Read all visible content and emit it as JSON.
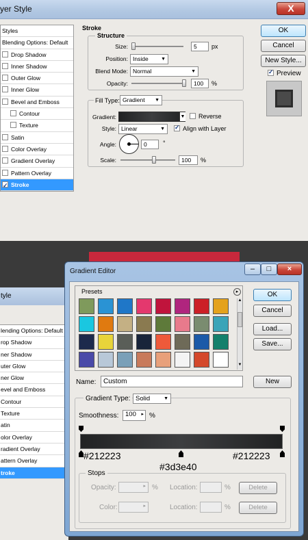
{
  "layer_style": {
    "title": "yer Style",
    "close": "X",
    "nav": [
      {
        "label": "Styles",
        "type": "header"
      },
      {
        "label": "Blending Options: Default",
        "type": "header"
      },
      {
        "label": "Drop Shadow",
        "checked": false
      },
      {
        "label": "Inner Shadow",
        "checked": false
      },
      {
        "label": "Outer Glow",
        "checked": false
      },
      {
        "label": "Inner Glow",
        "checked": false
      },
      {
        "label": "Bevel and Emboss",
        "checked": false
      },
      {
        "label": "Contour",
        "checked": false,
        "sub": true
      },
      {
        "label": "Texture",
        "checked": false,
        "sub": true
      },
      {
        "label": "Satin",
        "checked": false
      },
      {
        "label": "Color Overlay",
        "checked": false
      },
      {
        "label": "Gradient Overlay",
        "checked": false
      },
      {
        "label": "Pattern Overlay",
        "checked": false
      },
      {
        "label": "Stroke",
        "checked": true,
        "selected": true
      }
    ],
    "stroke": {
      "heading": "Stroke",
      "structure_heading": "Structure",
      "size_label": "Size:",
      "size_value": "5",
      "size_unit": "px",
      "position_label": "Position:",
      "position_value": "Inside",
      "blend_label": "Blend Mode:",
      "blend_value": "Normal",
      "opacity_label": "Opacity:",
      "opacity_value": "100",
      "opacity_unit": "%",
      "fill_type_label": "Fill Type:",
      "fill_type_value": "Gradient",
      "gradient_label": "Gradient:",
      "reverse_label": "Reverse",
      "style_label": "Style:",
      "style_value": "Linear",
      "align_label": "Align with Layer",
      "angle_label": "Angle:",
      "angle_value": "0",
      "angle_unit": "°",
      "scale_label": "Scale:",
      "scale_value": "100",
      "scale_unit": "%"
    },
    "buttons": {
      "ok": "OK",
      "cancel": "Cancel",
      "new_style": "New Style...",
      "preview": "Preview"
    }
  },
  "background_window": {
    "title": "tyle",
    "nav": [
      "lending Options: Default",
      "rop Shadow",
      "ner Shadow",
      "uter Glow",
      "ner Glow",
      "evel and Emboss",
      "Contour",
      "Texture",
      "atin",
      "olor Overlay",
      "radient Overlay",
      "attern Overlay",
      "troke"
    ]
  },
  "gradient_editor": {
    "title": "Gradient Editor",
    "presets_label": "Presets",
    "swatches": [
      [
        "#7f9a5c",
        "#2a93d4",
        "#1f77c8",
        "#e4386e",
        "#c0143c",
        "#b0257e",
        "#cc1f26",
        "#e4a21c"
      ],
      [
        "#1ac7e0",
        "#e07a10",
        "#c4b084",
        "#8a7a50",
        "#5e7a3a",
        "#e87a8c",
        "#7a8c70",
        "#3aa4b8"
      ],
      [
        "#1c2a4c",
        "#e8d43a",
        "#5a5e58",
        "#18243a",
        "#ee5a3a",
        "#6e6a58",
        "#1c5aa8",
        "#14806c"
      ],
      [
        "#4a4aa8",
        "#b8c8d8",
        "#7aa0b8",
        "#c87a5a",
        "#e8a07a",
        "#f4f4f4",
        "#d4482a",
        "#ffffff"
      ]
    ],
    "name_label": "Name:",
    "name_value": "Custom",
    "new_button": "New",
    "buttons": {
      "ok": "OK",
      "cancel": "Cancel",
      "load": "Load...",
      "save": "Save..."
    },
    "gradient_type_label": "Gradient Type:",
    "gradient_type_value": "Solid",
    "smoothness_label": "Smoothness:",
    "smoothness_value": "100",
    "smoothness_unit": "%",
    "gradient": {
      "start": "#212223",
      "mid": "#3d3e40",
      "end": "#212223"
    },
    "hex_left": "#212223",
    "hex_mid": "#3d3e40",
    "hex_right": "#212223",
    "stops_label": "Stops",
    "opacity_label": "Opacity:",
    "opacity_unit": "%",
    "location_label": "Location:",
    "location_unit": "%",
    "delete_label": "Delete",
    "color_label": "Color:"
  }
}
